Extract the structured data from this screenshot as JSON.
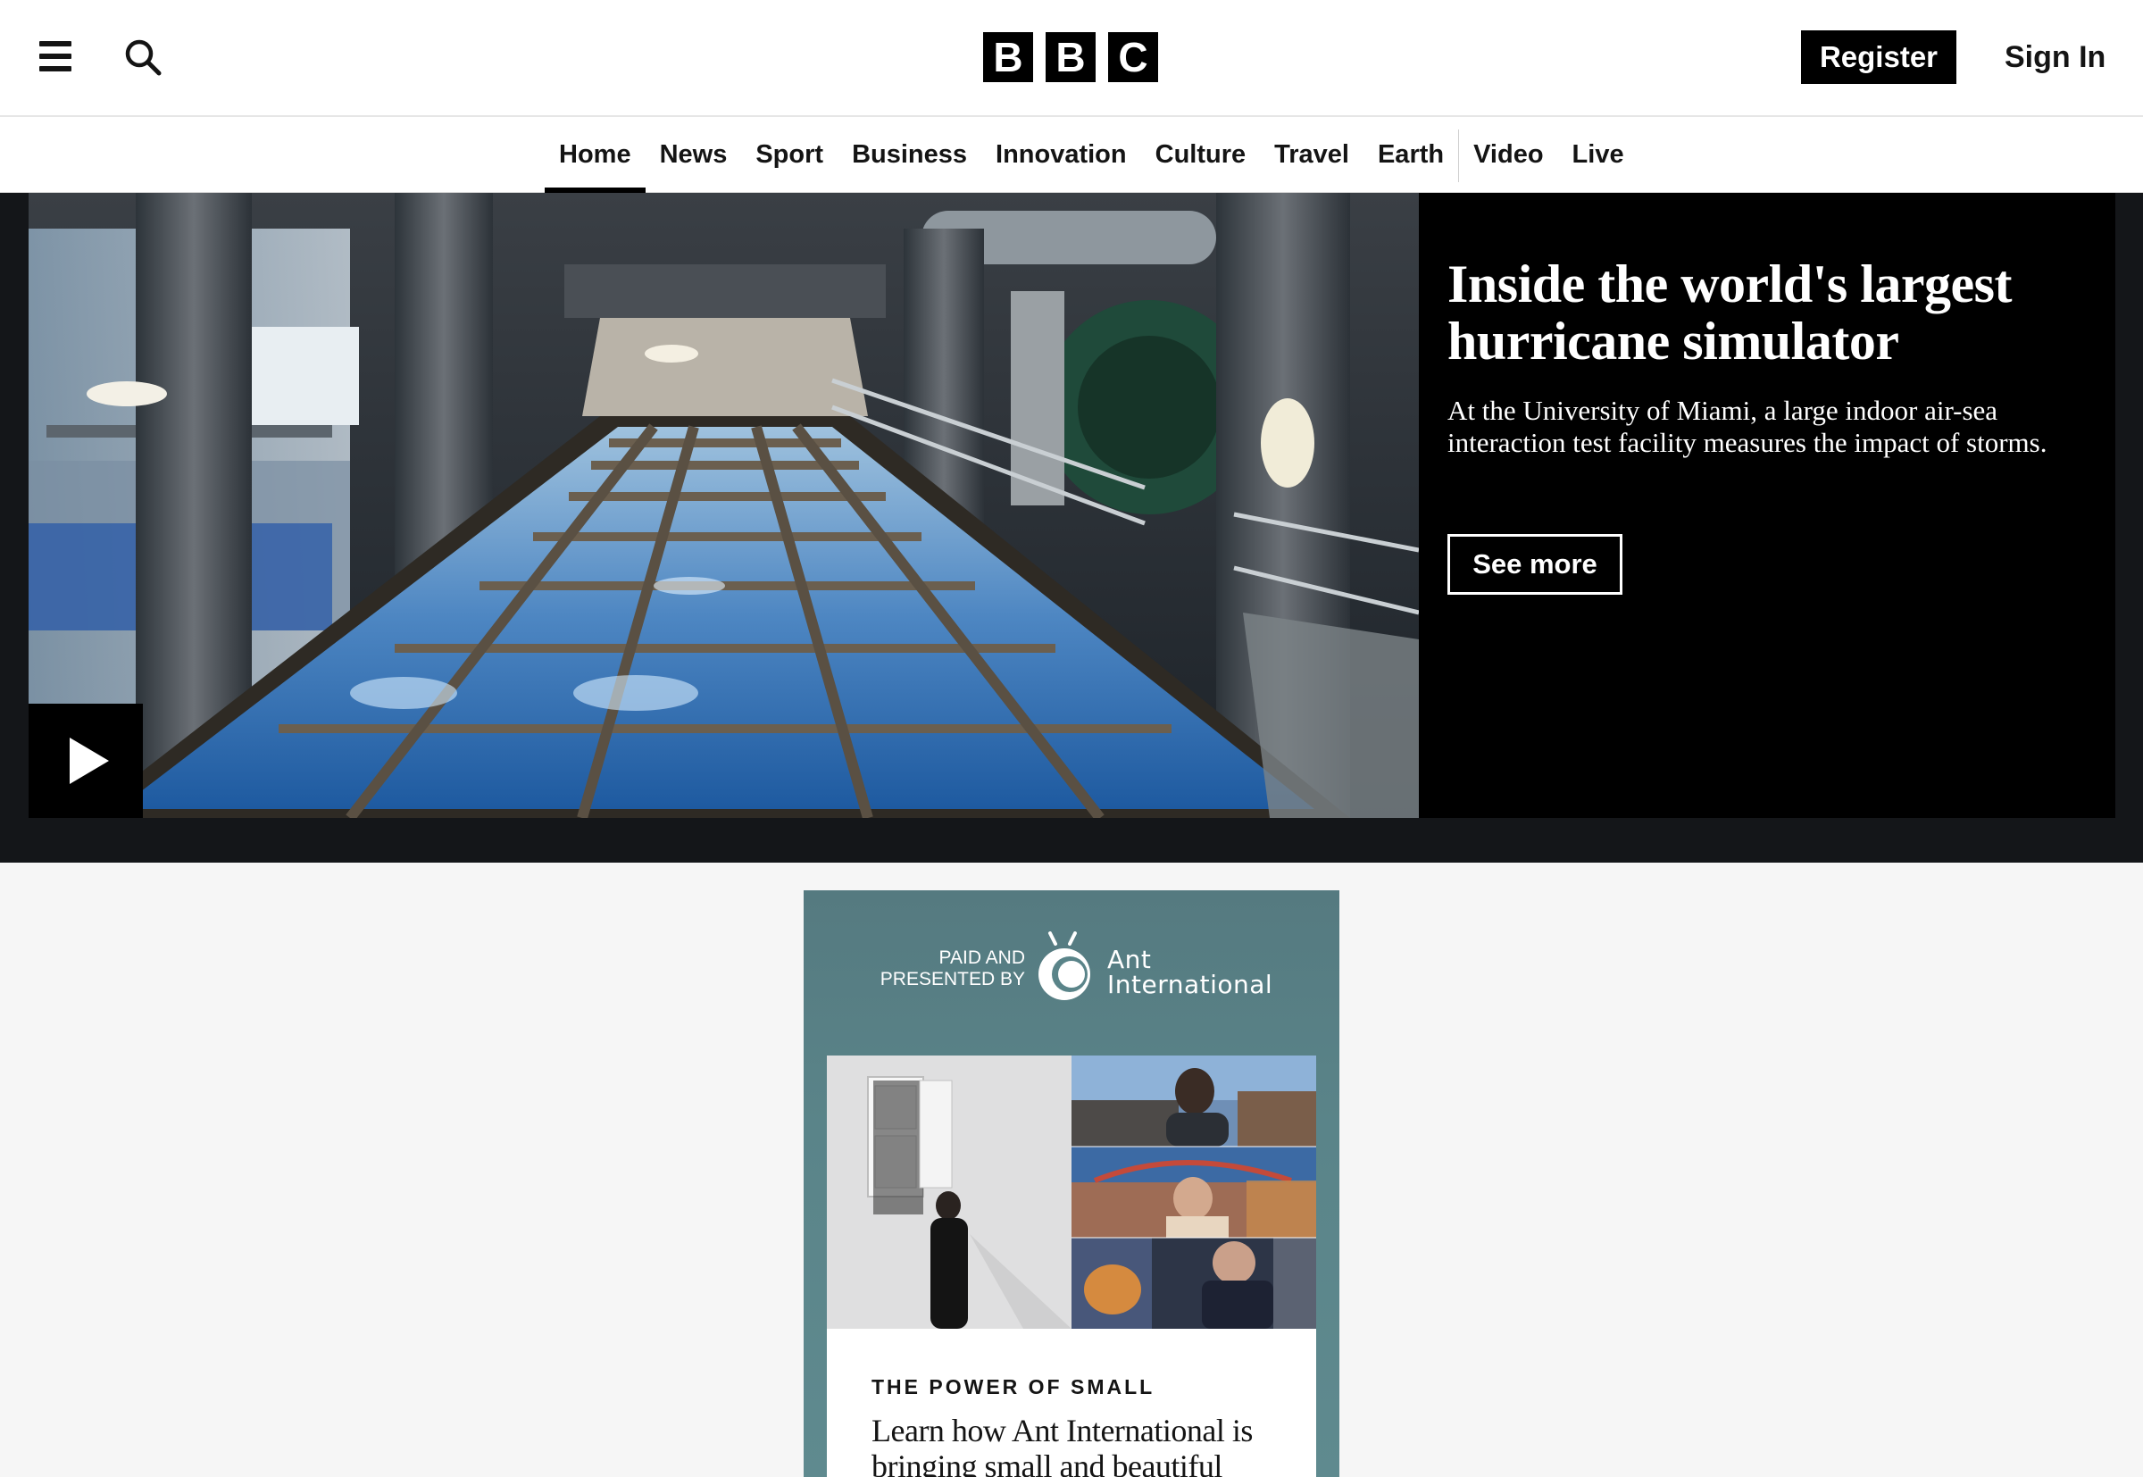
{
  "header": {
    "menu_icon": "hamburger-menu-icon",
    "search_icon": "search-icon",
    "logo_letters": [
      "B",
      "B",
      "C"
    ],
    "register_label": "Register",
    "signin_label": "Sign In"
  },
  "nav": {
    "active": "Home",
    "items": [
      {
        "label": "Home"
      },
      {
        "label": "News"
      },
      {
        "label": "Sport"
      },
      {
        "label": "Business"
      },
      {
        "label": "Innovation"
      },
      {
        "label": "Culture"
      },
      {
        "label": "Travel"
      },
      {
        "label": "Earth"
      },
      {
        "label": "Video"
      },
      {
        "label": "Live"
      }
    ]
  },
  "hero": {
    "title": "Inside the world's largest hurricane simulator",
    "summary": "At the University of Miami, a large indoor air-sea interaction test facility measures the impact of storms.",
    "cta_label": "See more",
    "play_icon": "play-icon"
  },
  "ad": {
    "paid_line1": "PAID AND",
    "paid_line2": "PRESENTED BY",
    "brand_line1": "Ant",
    "brand_line2": "International",
    "eyebrow": "THE POWER OF SMALL",
    "headline": "Learn how Ant International is bringing small and beautiful"
  },
  "colors": {
    "header_bg": "#ffffff",
    "hero_band": "#141619",
    "hero_panel": "#000000",
    "page_bg": "#f6f6f6",
    "ad_bg": "#5a8489"
  }
}
